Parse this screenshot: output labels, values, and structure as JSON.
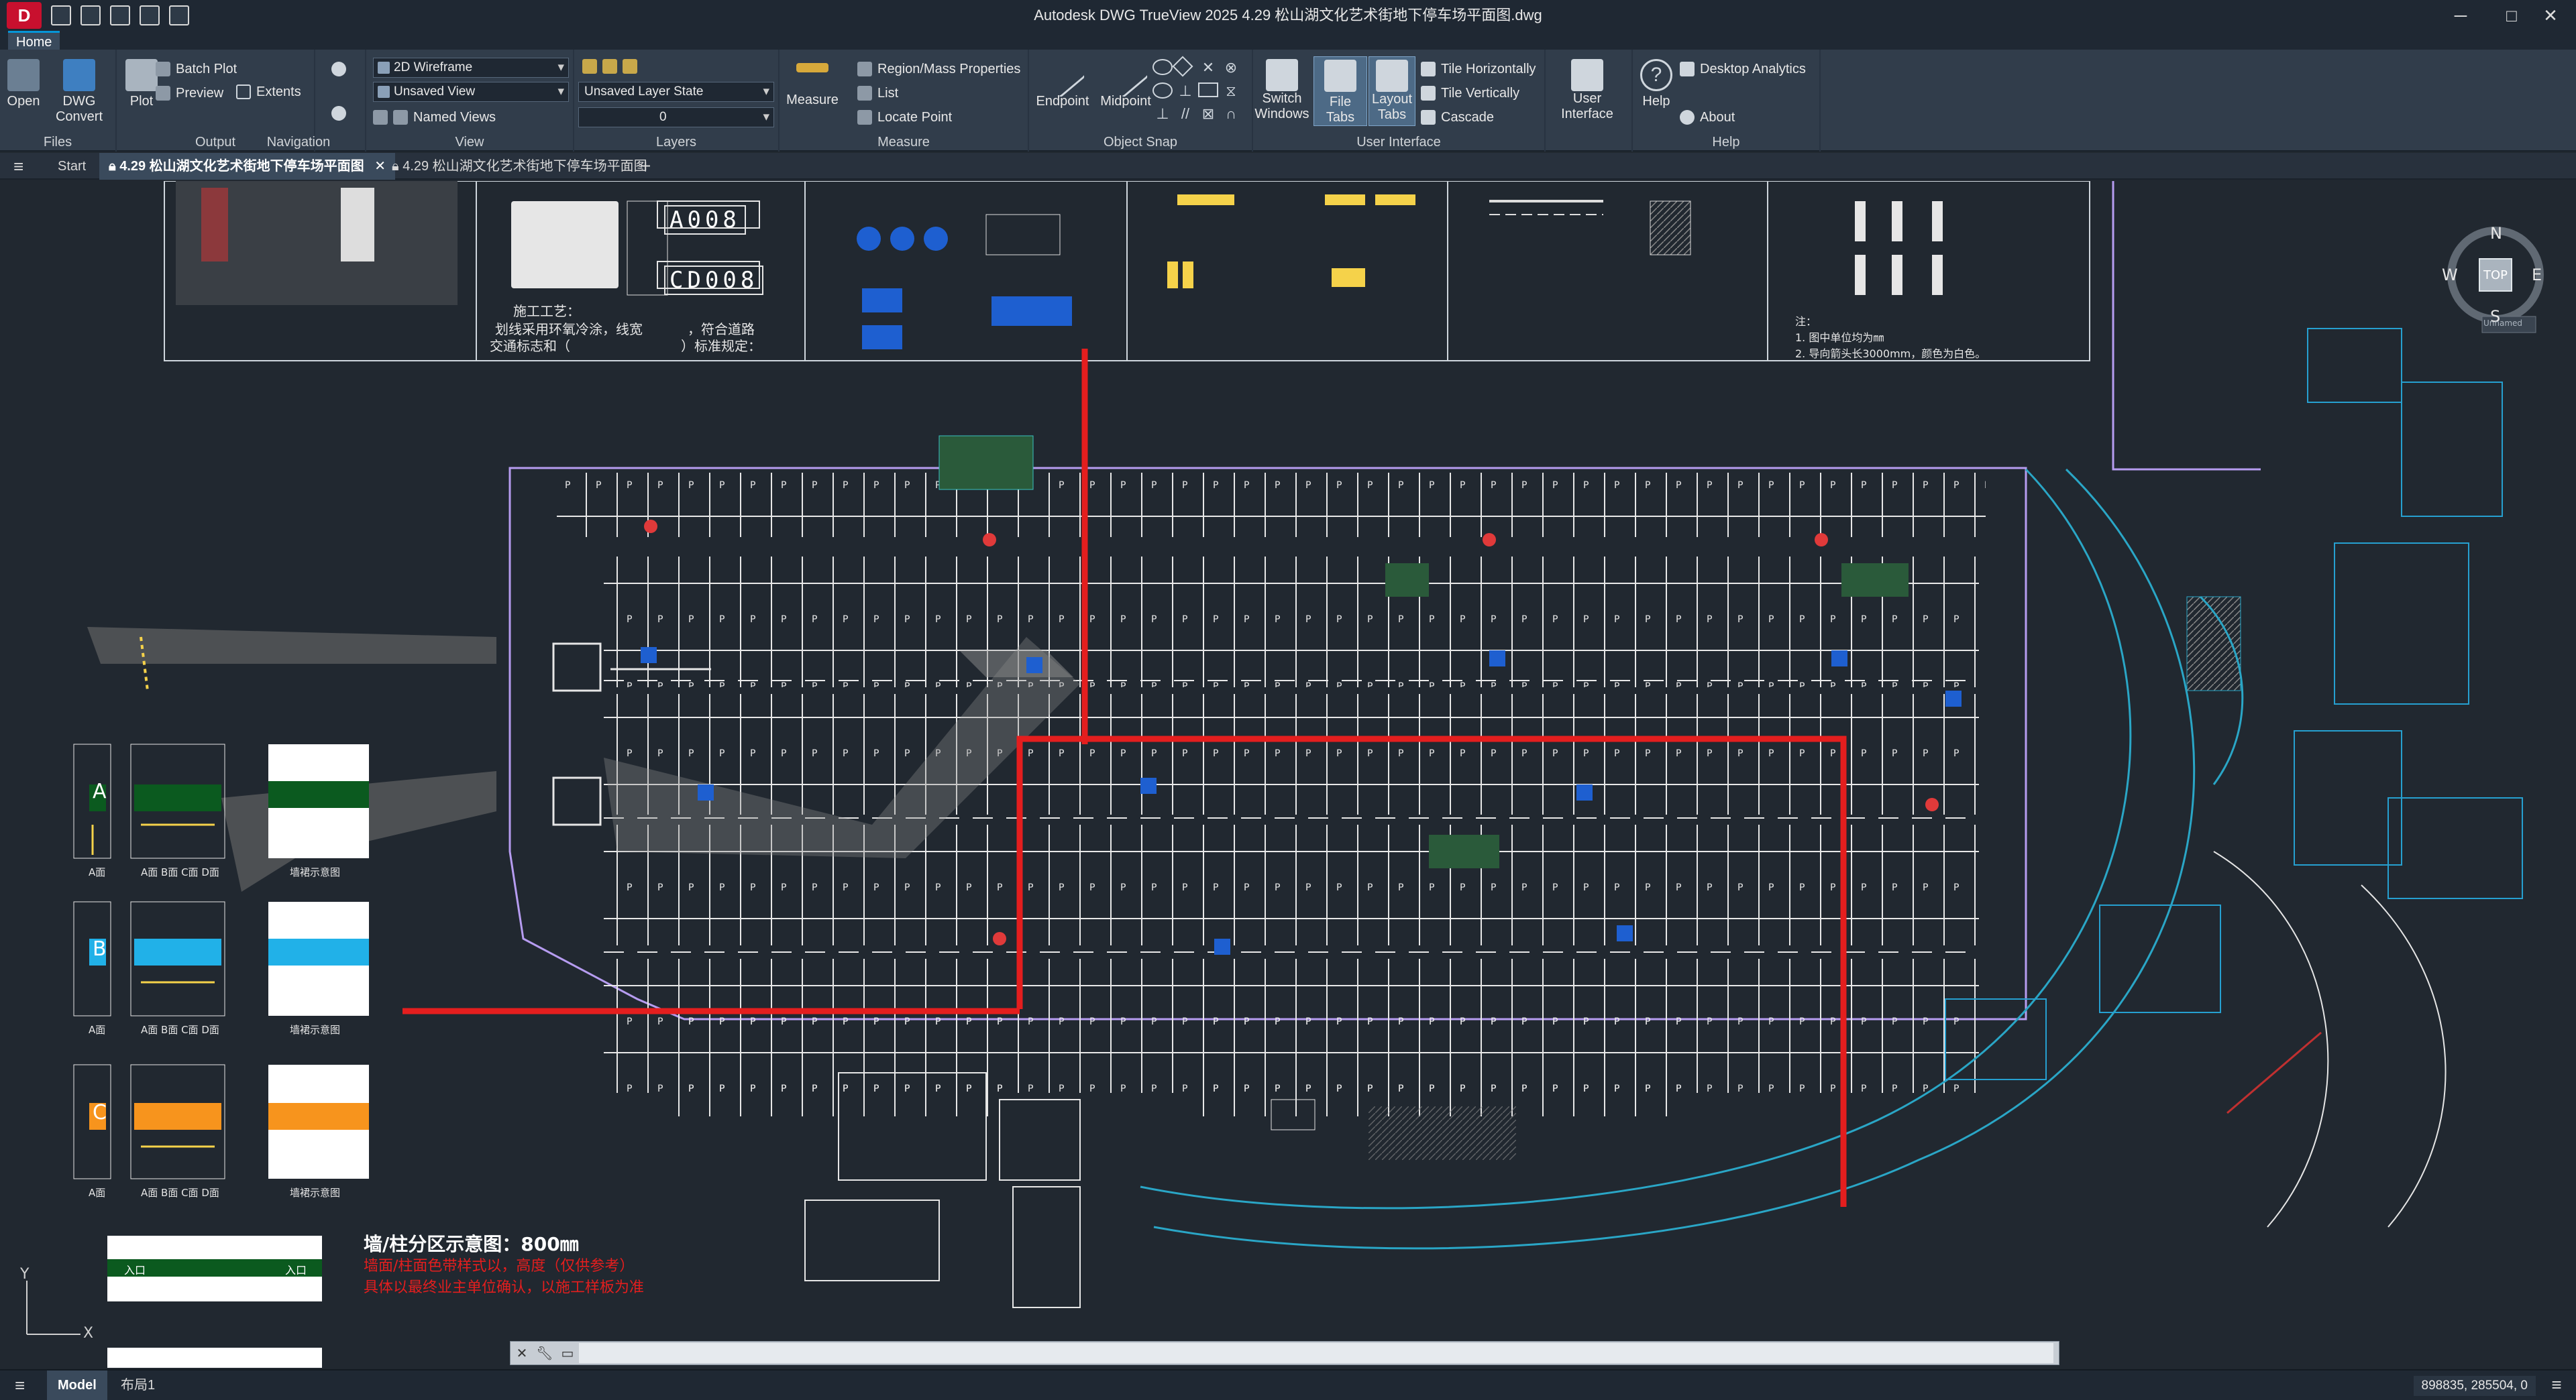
{
  "window": {
    "title": "Autodesk DWG TrueView 2025    4.29 松山湖文化艺术街地下停车场平面图.dwg",
    "minimize": "─",
    "maximize": "□",
    "close": "✕"
  },
  "app_logo": "D",
  "ribbon_tab": "Home",
  "ribbon": {
    "files": {
      "title": "Files",
      "open": "Open",
      "dwg_convert_1": "DWG",
      "dwg_convert_2": "Convert"
    },
    "output": {
      "title": "Output",
      "plot": "Plot",
      "batch_plot": "Batch Plot",
      "preview": "Preview"
    },
    "navigation": {
      "title": "Navigation",
      "extents": "Extents"
    },
    "view": {
      "title": "View",
      "visual_style": "2D Wireframe",
      "named_view": "Unsaved View",
      "named_views": "Named Views"
    },
    "layers": {
      "title": "Layers",
      "layer_state": "Unsaved Layer State",
      "current_layer": "0"
    },
    "measure": {
      "title": "Measure",
      "measure": "Measure",
      "region": "Region/Mass Properties",
      "list": "List",
      "locate": "Locate Point"
    },
    "object_snap": {
      "title": "Object Snap",
      "endpoint": "Endpoint",
      "midpoint": "Midpoint"
    },
    "user_interface": {
      "title": "User Interface",
      "switch_1": "Switch",
      "switch_2": "Windows",
      "file_tabs": "File Tabs",
      "layout_1": "Layout",
      "layout_2": "Tabs",
      "tile_h": "Tile Horizontally",
      "tile_v": "Tile Vertically",
      "cascade": "Cascade",
      "ui_1": "User",
      "ui_2": "Interface"
    },
    "help": {
      "title": "Help",
      "help": "Help",
      "analytics": "Desktop Analytics",
      "about": "About"
    }
  },
  "file_tabs": {
    "start": "Start",
    "tab1": "4.29 松山湖文化艺术街地下停车场平面图",
    "tab2": "4.29 松山湖文化艺术街地下停车场平面图",
    "add": "+"
  },
  "drawing": {
    "code1": "A008",
    "code2": "CD008",
    "construction_1": "施工工艺：",
    "construction_2": "划线采用环氧冷涂，线宽",
    "construction_3": "交通标志和（",
    "construction_4": "，符合道路",
    "construction_5": "）标准规定：",
    "note_title": "注：",
    "note_1": "1. 图中单位均为㎜",
    "note_2": "2. 导向箭头长3000mm，颜色为白色。",
    "label_a": "A面",
    "label_abcd": "A面 B面 C面 D面",
    "label_wall": "墙裙示意图",
    "zone_a": "A",
    "zone_b": "B",
    "zone_c": "C",
    "wall_title": "墙/柱分区示意图：800㎜",
    "wall_note_1": "墙面/柱面色带样式以，高度（仅供参考）",
    "wall_note_2": "具体以最终业主单位确认，以施工样板为准",
    "entry_left": "入口",
    "entry_right": "入口",
    "unnamed": "Unnamed"
  },
  "viewcube": {
    "n": "N",
    "s": "S",
    "e": "E",
    "w": "W",
    "top": "TOP"
  },
  "axis": {
    "y": "Y",
    "x": "X"
  },
  "status": {
    "model": "Model",
    "layout1": "布局1",
    "coords": "898835, 285504, 0"
  }
}
